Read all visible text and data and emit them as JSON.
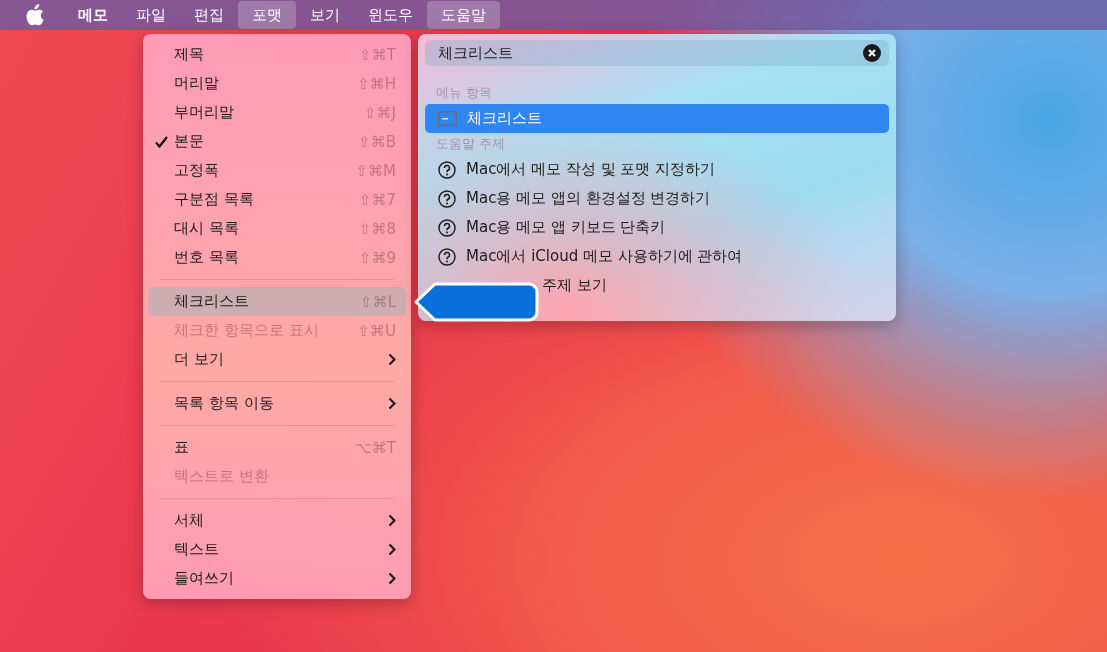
{
  "menubar": {
    "items": [
      {
        "label": "메모",
        "kind": "app",
        "selected": false
      },
      {
        "label": "파일",
        "kind": "menu",
        "selected": false
      },
      {
        "label": "편집",
        "kind": "menu",
        "selected": false
      },
      {
        "label": "포맷",
        "kind": "menu",
        "selected": true
      },
      {
        "label": "보기",
        "kind": "menu",
        "selected": false
      },
      {
        "label": "윈도우",
        "kind": "menu",
        "selected": false
      },
      {
        "label": "도움말",
        "kind": "menu",
        "selected": true
      }
    ]
  },
  "format_menu": {
    "items": [
      {
        "kind": "item",
        "label": "제목",
        "shortcut": "⇧⌘T",
        "checked": false,
        "disabled": false,
        "selected": false,
        "submenu": false
      },
      {
        "kind": "item",
        "label": "머리말",
        "shortcut": "⇧⌘H",
        "checked": false,
        "disabled": false,
        "selected": false,
        "submenu": false
      },
      {
        "kind": "item",
        "label": "부머리말",
        "shortcut": "⇧⌘J",
        "checked": false,
        "disabled": false,
        "selected": false,
        "submenu": false
      },
      {
        "kind": "item",
        "label": "본문",
        "shortcut": "⇧⌘B",
        "checked": true,
        "disabled": false,
        "selected": false,
        "submenu": false
      },
      {
        "kind": "item",
        "label": "고정폭",
        "shortcut": "⇧⌘M",
        "checked": false,
        "disabled": false,
        "selected": false,
        "submenu": false
      },
      {
        "kind": "item",
        "label": "구분점 목록",
        "shortcut": "⇧⌘7",
        "checked": false,
        "disabled": false,
        "selected": false,
        "submenu": false
      },
      {
        "kind": "item",
        "label": "대시 목록",
        "shortcut": "⇧⌘8",
        "checked": false,
        "disabled": false,
        "selected": false,
        "submenu": false
      },
      {
        "kind": "item",
        "label": "번호 목록",
        "shortcut": "⇧⌘9",
        "checked": false,
        "disabled": false,
        "selected": false,
        "submenu": false
      },
      {
        "kind": "separator"
      },
      {
        "kind": "item",
        "label": "체크리스트",
        "shortcut": "⇧⌘L",
        "checked": false,
        "disabled": false,
        "selected": true,
        "submenu": false
      },
      {
        "kind": "item",
        "label": "체크한 항목으로 표시",
        "shortcut": "⇧⌘U",
        "checked": false,
        "disabled": true,
        "selected": false,
        "submenu": false
      },
      {
        "kind": "item",
        "label": "더 보기",
        "checked": false,
        "disabled": false,
        "selected": false,
        "submenu": true
      },
      {
        "kind": "separator"
      },
      {
        "kind": "item",
        "label": "목록 항목 이동",
        "checked": false,
        "disabled": false,
        "selected": false,
        "submenu": true
      },
      {
        "kind": "separator"
      },
      {
        "kind": "item",
        "label": "표",
        "shortcut": "⌥⌘T",
        "checked": false,
        "disabled": false,
        "selected": false,
        "submenu": false
      },
      {
        "kind": "item",
        "label": "텍스트로 변환",
        "checked": false,
        "disabled": true,
        "selected": false,
        "submenu": false
      },
      {
        "kind": "separator"
      },
      {
        "kind": "item",
        "label": "서체",
        "checked": false,
        "disabled": false,
        "selected": false,
        "submenu": true
      },
      {
        "kind": "item",
        "label": "텍스트",
        "checked": false,
        "disabled": false,
        "selected": false,
        "submenu": true
      },
      {
        "kind": "item",
        "label": "들여쓰기",
        "checked": false,
        "disabled": false,
        "selected": false,
        "submenu": true
      }
    ]
  },
  "help_menu": {
    "search": {
      "value": "체크리스트"
    },
    "sections": [
      {
        "heading": "메뉴 항목",
        "items": [
          {
            "kind": "menu",
            "label": "체크리스트",
            "selected": true
          }
        ]
      },
      {
        "heading": "도움말 주제",
        "items": [
          {
            "kind": "topic",
            "label": "Mac에서 메모 작성 및 포맷 지정하기",
            "selected": false
          },
          {
            "kind": "topic",
            "label": "Mac용 메모 앱의 환경설정 변경하기",
            "selected": false
          },
          {
            "kind": "topic",
            "label": "Mac용 메모 앱 키보드 단축키",
            "selected": false
          },
          {
            "kind": "topic",
            "label": "Mac에서 iCloud 메모 사용하기에 관하여",
            "selected": false
          },
          {
            "kind": "more",
            "label": "주제 보기",
            "selected": false
          }
        ]
      }
    ]
  }
}
